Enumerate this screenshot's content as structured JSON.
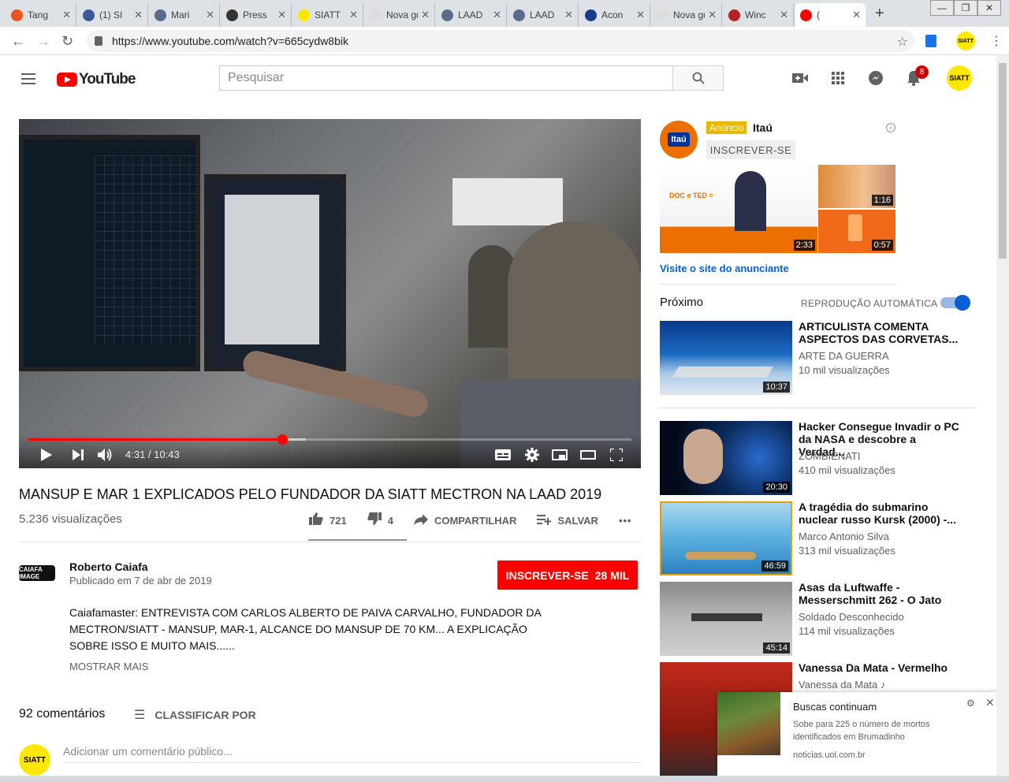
{
  "browser": {
    "tabs": [
      {
        "label": "Tang",
        "color": "#e8531f"
      },
      {
        "label": "(1) SI",
        "color": "#3b5998"
      },
      {
        "label": "Mari",
        "color": "#5a6a8a"
      },
      {
        "label": "Press",
        "color": "#333333"
      },
      {
        "label": "SIATT",
        "color": "#ffe800"
      },
      {
        "label": "Nova gui",
        "color": "#dddddd"
      },
      {
        "label": "LAAD",
        "color": "#5a6a8a"
      },
      {
        "label": "LAAD",
        "color": "#5a6a8a"
      },
      {
        "label": "Acon",
        "color": "#1a3a8a"
      },
      {
        "label": "Nova gui",
        "color": "#dddddd"
      },
      {
        "label": "Winc",
        "color": "#b22222"
      },
      {
        "label": "(",
        "color": "#ff0000",
        "active": true
      }
    ],
    "url": "https://www.youtube.com/watch?v=665cydw8bik",
    "new_tab": "+",
    "close_glyph": "✕"
  },
  "header": {
    "logo_text": "YouTube",
    "search_placeholder": "Pesquisar",
    "notification_count": "8",
    "avatar_label": "SIATT"
  },
  "player": {
    "current_time": "4:31",
    "duration": "10:43",
    "time_display": "4:31 / 10:43",
    "played_fraction": 0.421,
    "loaded_fraction": 0.46
  },
  "video": {
    "title": "MANSUP E MAR 1 EXPLICADOS PELO FUNDADOR DA SIATT MECTRON NA LAAD 2019",
    "views": "5.236 visualizações",
    "likes": "721",
    "dislikes": "4",
    "share_label": "COMPARTILHAR",
    "save_label": "SALVAR",
    "more_glyph": "•••"
  },
  "channel": {
    "logo_text": "CAIAFA IMAGE",
    "name": "Roberto Caiafa",
    "published": "Publicado em 7 de abr de 2019",
    "subscribe_label": "INSCREVER-SE",
    "subscriber_count": "28 MIL",
    "description": "Caiafamaster: ENTREVISTA COM CARLOS ALBERTO DE PAIVA CARVALHO, FUNDADOR DA MECTRON/SIATT - MANSUP, MAR-1, ALCANCE DO MANSUP DE 70 KM... A EXPLICAÇÃO SOBRE ISSO E MUITO MAIS......",
    "show_more": "MOSTRAR MAIS"
  },
  "comments": {
    "count": "92 comentários",
    "sort_label": "CLASSIFICAR POR",
    "placeholder": "Adicionar um comentário público..."
  },
  "ad": {
    "logo_text": "Itaú",
    "badge": "Anúncio",
    "advertiser": "Itaú",
    "subscribe_label": "INSCREVER-SE",
    "thumb_main_duration": "2:33",
    "thumb_main_caption": "DOC e TED =",
    "thumb_top_duration": "1:16",
    "thumb_bottom_duration": "0:57",
    "link": "Visite o site do anunciante"
  },
  "sidebar": {
    "next_label": "Próximo",
    "autoplay_label": "REPRODUÇÃO AUTOMÁTICA",
    "autoplay_on": true,
    "items": [
      {
        "title": "ARTICULISTA COMENTA ASPECTOS DAS CORVETAS...",
        "channel": "ARTE DA GUERRA",
        "views": "10 mil visualizações",
        "duration": "10:37"
      },
      {
        "title": "Hacker Consegue Invadir o PC da NASA e descobre a Verdad...",
        "channel": "ZOMBIENATI",
        "views": "410 mil visualizações",
        "duration": "20:30"
      },
      {
        "title": "A tragédia do submarino nuclear russo Kursk (2000) -...",
        "channel": "Marco Antonio Silva",
        "views": "313 mil visualizações",
        "duration": "46:59"
      },
      {
        "title": "Asas da Luftwaffe - Messerschmitt 262 - O Jato",
        "channel": "Soldado Desconhecido",
        "views": "114 mil visualizações",
        "duration": "45:14"
      },
      {
        "title": "Vanessa Da Mata - Vermelho",
        "channel": "Vanessa da Mata ♪",
        "views": "",
        "duration": ""
      }
    ]
  },
  "notification": {
    "title": "Buscas continuam",
    "body": "Sobe para 225 o número de mortos identificados em Brumadinho",
    "source": "noticias.uol.com.br"
  }
}
